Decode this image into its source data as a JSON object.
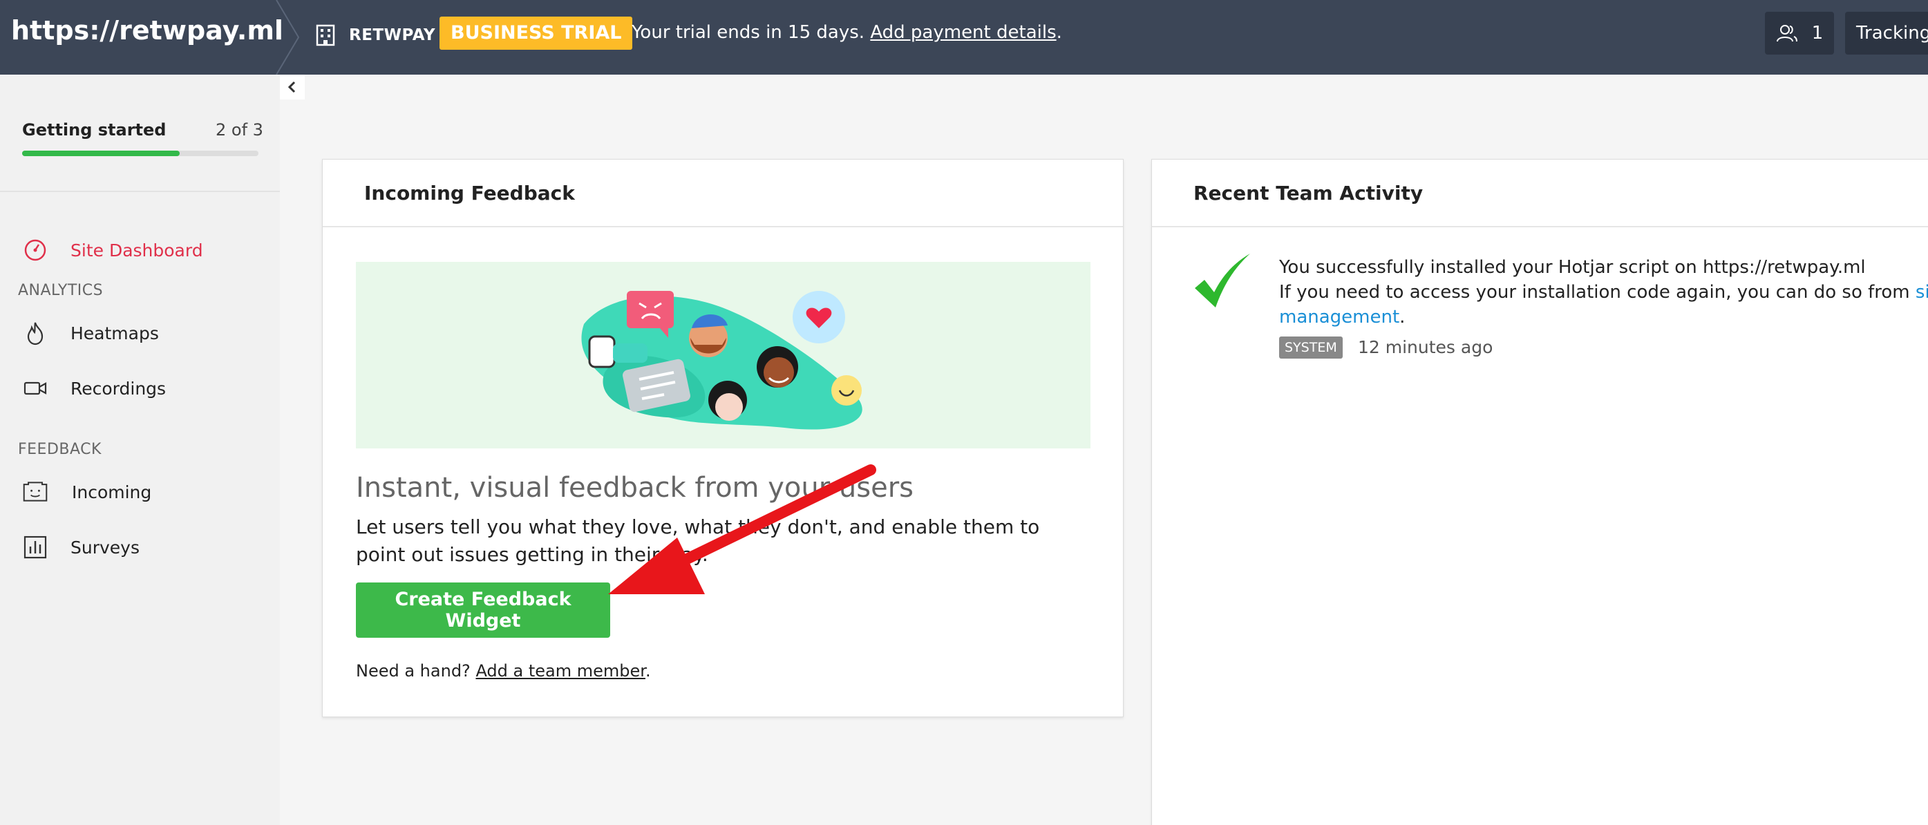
{
  "topbar": {
    "site_url": "https://retwpay.ml",
    "org_name": "RETWPAY",
    "trial_badge": "BUSINESS TRIAL",
    "trial_text": "Your trial ends in 15 days.",
    "payment_link": "Add payment details",
    "trial_suffix": ".",
    "users_count": "1",
    "tracking_label": "Tracking"
  },
  "sidebar": {
    "getting_started": "Getting started",
    "progress_text": "2 of 3",
    "progress_fraction": 0.667,
    "site_dashboard": "Site Dashboard",
    "analytics_section": "ANALYTICS",
    "heatmaps": "Heatmaps",
    "recordings": "Recordings",
    "feedback_section": "FEEDBACK",
    "incoming": "Incoming",
    "surveys": "Surveys"
  },
  "feedback_card": {
    "title": "Incoming Feedback",
    "headline": "Instant, visual feedback from your users",
    "description": "Let users tell you what they love, what they don't, and enable them to point out issues getting in their way.",
    "cta": "Create Feedback Widget",
    "help_prefix": "Need a hand?",
    "help_link": "Add a team member",
    "help_suffix": "."
  },
  "activity_card": {
    "title": "Recent Team Activity",
    "line1": "You successfully installed your Hotjar script on https://retwpay.ml",
    "line2": "If you need to access your installation code again, you can do so from",
    "link": "site management",
    "link_suffix": ".",
    "badge": "SYSTEM",
    "time": "12 minutes ago"
  },
  "colors": {
    "topbar": "#3c4657",
    "trial_badge": "#fdbb27",
    "active_nav": "#e0304a",
    "cta": "#3db94a",
    "check": "#2eb82e",
    "arrow": "#e8161b",
    "link": "#1a8fd6"
  }
}
